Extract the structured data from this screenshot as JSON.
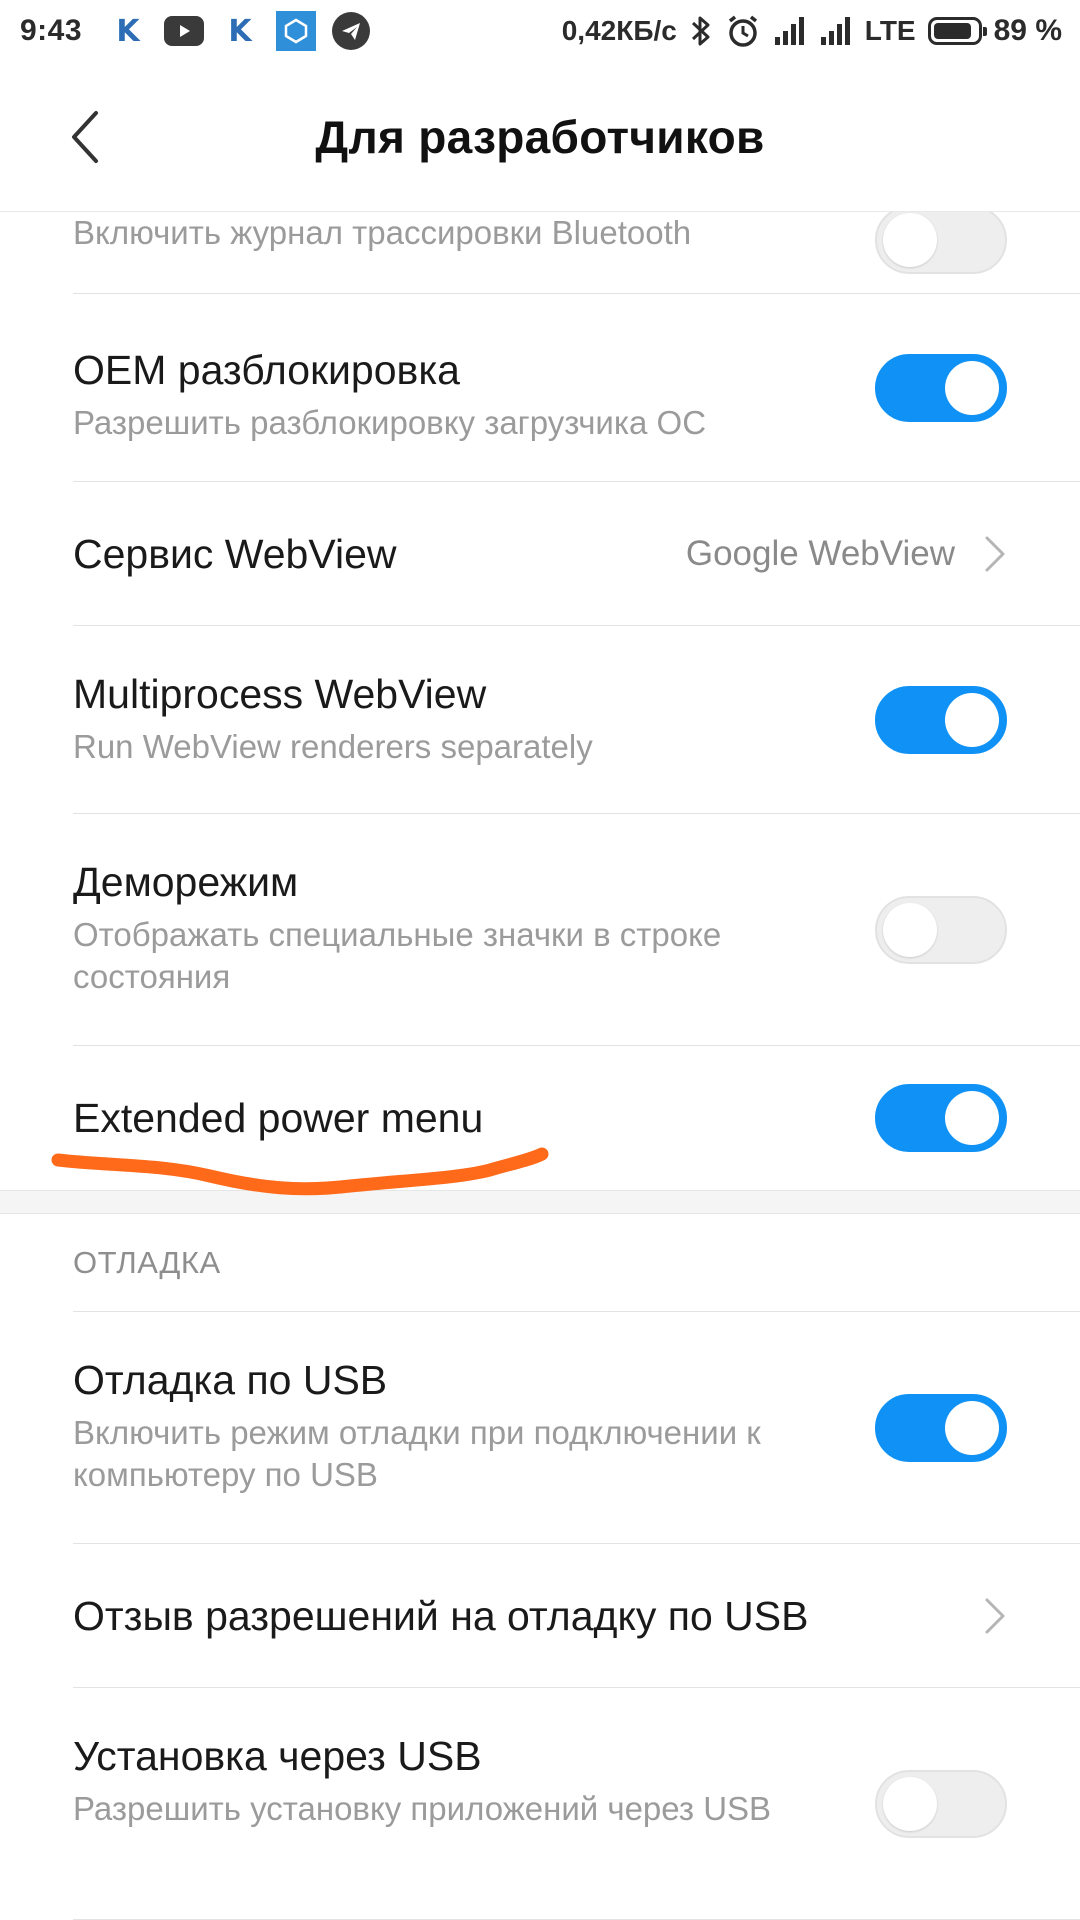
{
  "status_bar": {
    "time": "9:43",
    "left_icons": [
      "k-icon",
      "youtube-icon",
      "k-icon",
      "mi-icon",
      "telegram-icon"
    ],
    "k_glyph": "K",
    "speed": "0,42КБ/с",
    "network": "LTE",
    "battery_percent_text": "89 %",
    "battery_level": 0.89
  },
  "header": {
    "title": "Для разработчиков"
  },
  "colors": {
    "accent": "#0f91f5",
    "annotation": "#ff6a1a"
  },
  "rows": [
    {
      "title": "",
      "subtitle": "Включить журнал трассировки Bluetooth",
      "toggle": false
    },
    {
      "title": "OEM разблокировка",
      "subtitle": "Разрешить разблокировку загрузчика ОС",
      "toggle": true
    },
    {
      "title": "Сервис WebView",
      "value": "Google WebView"
    },
    {
      "title": "Multiprocess WebView",
      "subtitle": "Run WebView renderers separately",
      "toggle": true
    },
    {
      "title": "Деморежим",
      "subtitle": "Отображать специальные значки в строке состояния",
      "toggle": false
    },
    {
      "title": "Extended power menu",
      "toggle": true
    }
  ],
  "debug_section": {
    "header": "ОТЛАДКА",
    "rows": [
      {
        "title": "Отладка по USB",
        "subtitle": "Включить режим отладки при подключении к компьютеру по USB",
        "toggle": true
      },
      {
        "title": "Отзыв разрешений на отладку по USB"
      },
      {
        "title": "Установка через USB",
        "subtitle": "Разрешить установку приложений через USB",
        "toggle": false
      }
    ]
  }
}
